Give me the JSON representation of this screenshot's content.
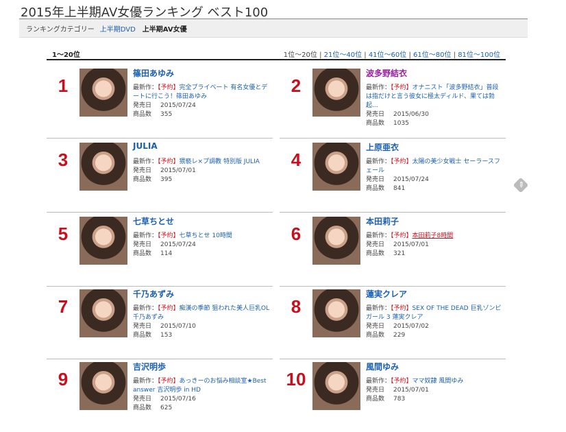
{
  "page_title": "2015年上半期AV女優ランキング ベスト100",
  "category_bar": {
    "label": "ランキングカテゴリー",
    "link": "上半期DVD",
    "current": "上半期AV女優"
  },
  "range_label": "1〜20位",
  "pager": {
    "current": "1位〜20位",
    "sep": " | ",
    "links": [
      "21位〜40位",
      "41位〜60位",
      "61位〜80位",
      "81位〜100位"
    ]
  },
  "labels": {
    "latest": "最新作",
    "release": "発売日",
    "items": "商品数",
    "colon": "：",
    "tag": "【予約】"
  },
  "entries": [
    {
      "rank": "1",
      "name": "篠田あゆみ",
      "work": "完全プライベート 有名女優とデートに行こう！篠田あゆみ",
      "release": "2015/07/24",
      "items": "355"
    },
    {
      "rank": "2",
      "name": "波多野結衣",
      "work": "オナニスト「波多野結衣」普段は指だけと言う彼女に極太ディルド、果ては勃起...",
      "release": "2015/06/30",
      "items": "1035"
    },
    {
      "rank": "3",
      "name": "JULIA",
      "work": "猥褻レ×プ調教 特別版 JULIA",
      "release": "2015/07/01",
      "items": "395"
    },
    {
      "rank": "4",
      "name": "上原亜衣",
      "work": "太陽の美少女戦士 セーラースフェール",
      "release": "2015/07/24",
      "items": "841"
    },
    {
      "rank": "5",
      "name": "七草ちとせ",
      "work": "七草ちとせ 10時間",
      "release": "2015/07/24",
      "items": "114"
    },
    {
      "rank": "6",
      "name": "本田莉子",
      "work": "本田莉子8時間",
      "release": "2015/07/01",
      "items": "321"
    },
    {
      "rank": "7",
      "name": "千乃あずみ",
      "work": "痴漢の季節 狙われた美人巨乳OL 千乃あずみ",
      "release": "2015/07/10",
      "items": "153"
    },
    {
      "rank": "8",
      "name": "蓮実クレア",
      "work": "SEX OF THE DEAD 巨乳ゾンビガール 3 蓮実クレア",
      "release": "2015/07/02",
      "items": "229"
    },
    {
      "rank": "9",
      "name": "吉沢明歩",
      "work": "あっきーのお悩み相談室★Best answer 吉沢明歩 in HD",
      "release": "2015/07/16",
      "items": "625"
    },
    {
      "rank": "10",
      "name": "風間ゆみ",
      "work": "ママ奴隷 風間ゆみ",
      "release": "2015/07/01",
      "items": "783"
    }
  ]
}
